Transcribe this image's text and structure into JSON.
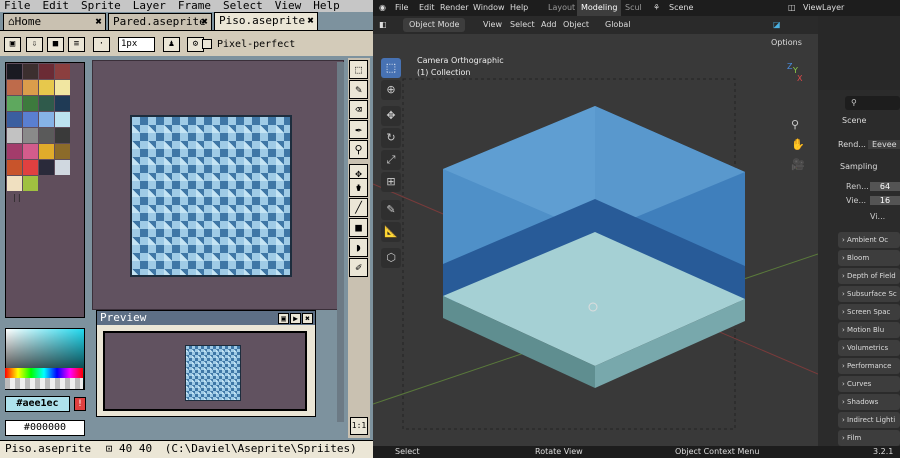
{
  "aseprite": {
    "menu": [
      "File",
      "Edit",
      "Sprite",
      "Layer",
      "Frame",
      "Select",
      "View",
      "Help"
    ],
    "tabs": [
      {
        "label": "Home",
        "close": "✖"
      },
      {
        "label": "Pared.aseprite",
        "close": "✖"
      },
      {
        "label": "Piso.aseprite",
        "close": "✖"
      }
    ],
    "toolbar": {
      "brush_size": "1px",
      "pixel_perfect": "Pixel-perfect"
    },
    "palette_colors": [
      "#1a1a22",
      "#3c2f2f",
      "#6b2b35",
      "#8b3f3f",
      "#be6b4b",
      "#db9d4b",
      "#e7c84c",
      "#f1e6a1",
      "#5ea85e",
      "#3d7a3d",
      "#2f5a4b",
      "#1f3a55",
      "#3b5fa0",
      "#5a7fd1",
      "#86b3e6",
      "#bce3f0",
      "#c2c2c2",
      "#8a8a8a",
      "#5a5a5a",
      "#3a3a3a",
      "#a33c6b",
      "#d35c8c",
      "#e0ab2b",
      "#8c6b2a",
      "#c8542b",
      "#e04040",
      "#2a2a3a",
      "#d0d8e0",
      "#f0e0c0",
      "#a0c040"
    ],
    "foreground_hex": "#aee1ec",
    "warning_glyph": "!",
    "background_hex": "#000000",
    "preview_title": "Preview",
    "preview_buttons": [
      "▣",
      "▶",
      "✖"
    ],
    "tools": [
      "⬚",
      "✎",
      "⌫",
      "✒",
      "⚲",
      "✥",
      "⚱",
      "╱",
      "■",
      "◗",
      "✐"
    ],
    "zoom_ratio": "1:1",
    "status": {
      "file": "Piso.aseprite",
      "size": "40 40",
      "path": "(C:\\Daviel\\Aseprite\\Spriites)"
    }
  },
  "blender": {
    "menu": [
      "File",
      "Edit",
      "Render",
      "Window",
      "Help"
    ],
    "workspaces": [
      "Layout",
      "Modeling",
      "Scul"
    ],
    "scene": "Scene",
    "view_layer": "ViewLayer",
    "header": {
      "mode": "Object Mode",
      "menus": [
        "View",
        "Select",
        "Add",
        "Object"
      ],
      "transform": "Global"
    },
    "options": "Options",
    "viewport_info": {
      "camera": "Camera Orthographic",
      "collection": "(1) Collection"
    },
    "gizmo": {
      "x": "X",
      "y": "Y",
      "z": "Z"
    },
    "properties": {
      "scene_label": "Scene",
      "render_engine_label": "Rend...",
      "engine": "Eevee",
      "sampling": "Sampling",
      "render_label": "Ren...",
      "render_samples": "64",
      "viewport_label": "Vie...",
      "viewport_samples": "16",
      "vi_label": "Vi...",
      "sections": [
        "Ambient Oc",
        "Bloom",
        "Depth of Field",
        "Subsurface Sc",
        "Screen Spac",
        "Motion Blu",
        "Volumetrics",
        "Performance",
        "Curves",
        "Shadows",
        "Indirect Lighti",
        "Film"
      ]
    },
    "status": {
      "select": "Select",
      "rotate": "Rotate View",
      "context": "Object Context Menu",
      "version": "3.2.1"
    }
  }
}
